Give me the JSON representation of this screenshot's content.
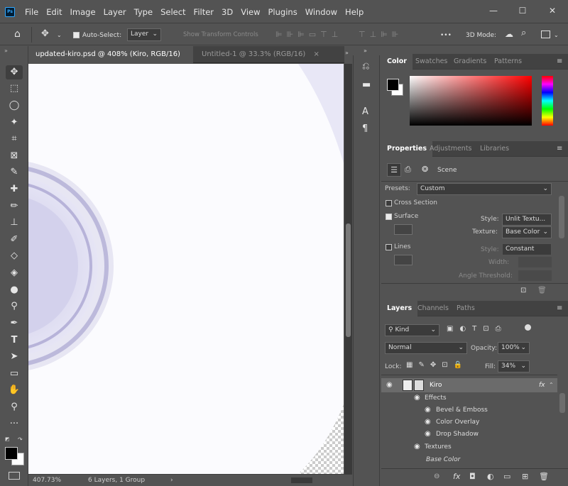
{
  "app": {
    "logo": "Ps"
  },
  "menu": [
    "File",
    "Edit",
    "Image",
    "Layer",
    "Type",
    "Select",
    "Filter",
    "3D",
    "View",
    "Plugins",
    "Window",
    "Help"
  ],
  "window_controls": {
    "minimize": "—",
    "maximize": "☐",
    "close": "✕"
  },
  "options_bar": {
    "auto_select_label": "Auto-Select:",
    "auto_select_value": "Layer",
    "show_transform": "Show Transform Controls",
    "mode_3d": "3D Mode:"
  },
  "doc_tabs": [
    {
      "label": "updated-kiro.psd @ 408% (Kiro, RGB/16) *",
      "close": "×"
    },
    {
      "label": "Untitled-1 @ 33.3% (RGB/16)",
      "close": "×"
    }
  ],
  "status": {
    "zoom": "407.73%",
    "info": "6 Layers, 1 Group"
  },
  "color_panel": {
    "tabs": [
      "Color",
      "Swatches",
      "Gradients",
      "Patterns"
    ],
    "fg_color": "#000000",
    "bg_color": "#ffffff",
    "accent": "#ff0000"
  },
  "properties": {
    "tabs": [
      "Properties",
      "Adjustments",
      "Libraries"
    ],
    "scene_label": "Scene",
    "presets_label": "Presets:",
    "presets_value": "Custom",
    "cross_section": "Cross Section",
    "surface": "Surface",
    "style_label": "Style:",
    "style_value": "Unlit Textu...",
    "texture_label": "Texture:",
    "texture_value": "Base Color",
    "lines": "Lines",
    "lines_style_label": "Style:",
    "lines_style_value": "Constant",
    "width_label": "Width:",
    "angle_label": "Angle Threshold:"
  },
  "layers": {
    "tabs": [
      "Layers",
      "Channels",
      "Paths"
    ],
    "kind_label": "Kind",
    "blend_mode": "Normal",
    "opacity_label": "Opacity:",
    "opacity_value": "100%",
    "lock_label": "Lock:",
    "fill_label": "Fill:",
    "fill_value": "34%",
    "rows": [
      {
        "name": "Kiro",
        "fx": "fx"
      },
      {
        "name": "Effects"
      },
      {
        "name": "Bevel & Emboss"
      },
      {
        "name": "Color Overlay"
      },
      {
        "name": "Drop Shadow"
      },
      {
        "name": "Textures"
      },
      {
        "name": "Base Color"
      }
    ],
    "bottom_icons": [
      "link-icon",
      "fx-icon",
      "mask-icon",
      "adjustment-icon",
      "group-icon",
      "new-layer-icon",
      "trash-icon"
    ],
    "fx_glyph": "fx"
  },
  "icons": {
    "home": "⌂",
    "move": "✥",
    "dots": "•••",
    "search": "⌕",
    "eye": "👁"
  }
}
